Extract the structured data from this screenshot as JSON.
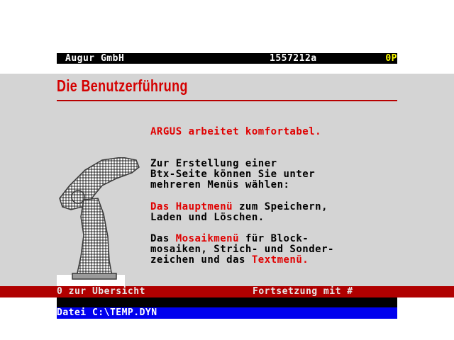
{
  "header": {
    "provider": "Augur GmbH",
    "page_number": "1557212a",
    "price": "0P"
  },
  "page": {
    "title": "Die Benutzerführung",
    "headline": "ARGUS arbeitet komfortabel.",
    "intro": "Zur Erstellung einer\nBtx-Seite können Sie unter\nmehreren Menüs wählen:",
    "menu1_name": "Das Hauptmenü",
    "menu1_text_a": " zum Speichern,",
    "menu1_text_b": "Laden und Löschen.",
    "menu2_prefix": "Das ",
    "menu2_name": "Mosaikmenü",
    "menu2_text_a": " für Block-",
    "menu2_text_b": "mosaiken, Strich- und Sonder-",
    "menu2_text_c": "zeichen und das ",
    "menu3_name": "Textmenü",
    "menu3_suffix": "."
  },
  "footer": {
    "back_label": "0 zur Übersicht",
    "next_label": "Fortsetzung mit #",
    "file_label": "Datei C:\\TEMP.DYN"
  },
  "colors": {
    "accent_red": "#e00000",
    "panel_grey": "#d4d4d4",
    "file_bar_blue": "#0000ee",
    "price_yellow": "#ffff00"
  },
  "icons": {
    "mascot": "spirit-of-ecstasy-figure-icon"
  }
}
